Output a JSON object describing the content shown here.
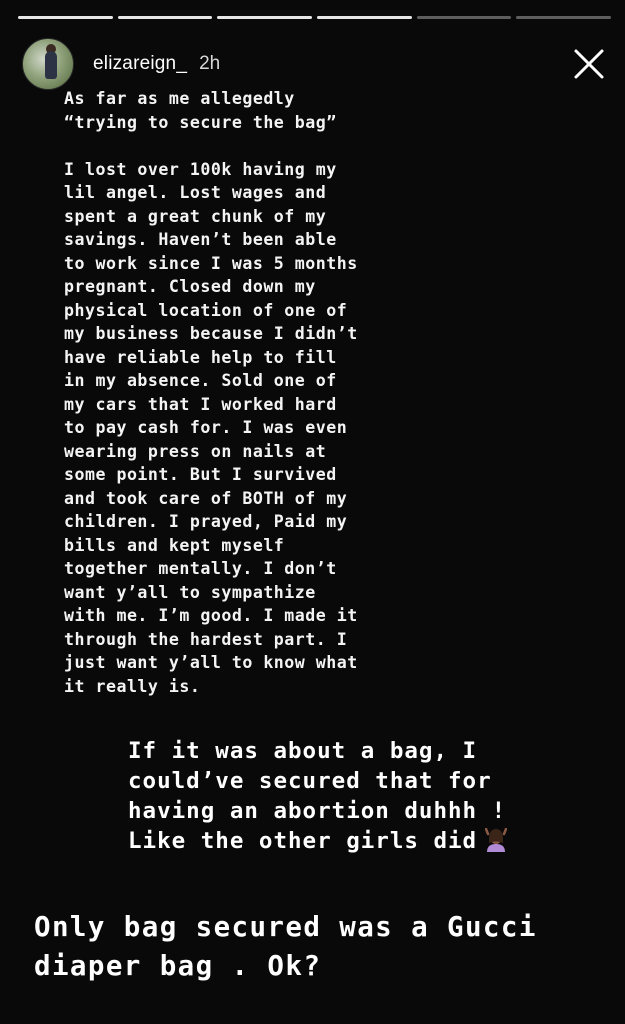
{
  "story": {
    "segments_total": 6,
    "segments_done": 4
  },
  "header": {
    "username": "elizareign_",
    "time": "2h"
  },
  "body_text": "As far as me allegedly\n“trying to secure the bag”\n\nI lost over 100k having my\nlil angel. Lost wages and\nspent a great chunk of my\nsavings. Haven’t been able\nto work since I was 5 months\npregnant. Closed down my\nphysical location of one of\nmy business because I didn’t\nhave reliable help to fill\nin my absence. Sold one of\nmy cars that I worked hard\nto pay cash for. I was even\nwearing press on nails at\nsome point. But I survived\nand took care of BOTH of my\nchildren. I prayed, Paid my\nbills and kept myself\ntogether mentally. I don’t\nwant y’all to sympathize\nwith me. I’m good. I made it\nthrough the hardest part. I\njust want y’all to know what\nit really is.",
  "caption1": "If it was about a bag, I\ncould’ve secured that for\nhaving an abortion duhhh !\nLike the other girls did",
  "caption1_emoji": "woman-gesturing-ok-emoji",
  "caption2": "Only bag secured was a Gucci\ndiaper bag . Ok?",
  "icons": {
    "close": "close-icon"
  },
  "colors": {
    "background": "#0a0909",
    "text": "#f4f4f4"
  }
}
